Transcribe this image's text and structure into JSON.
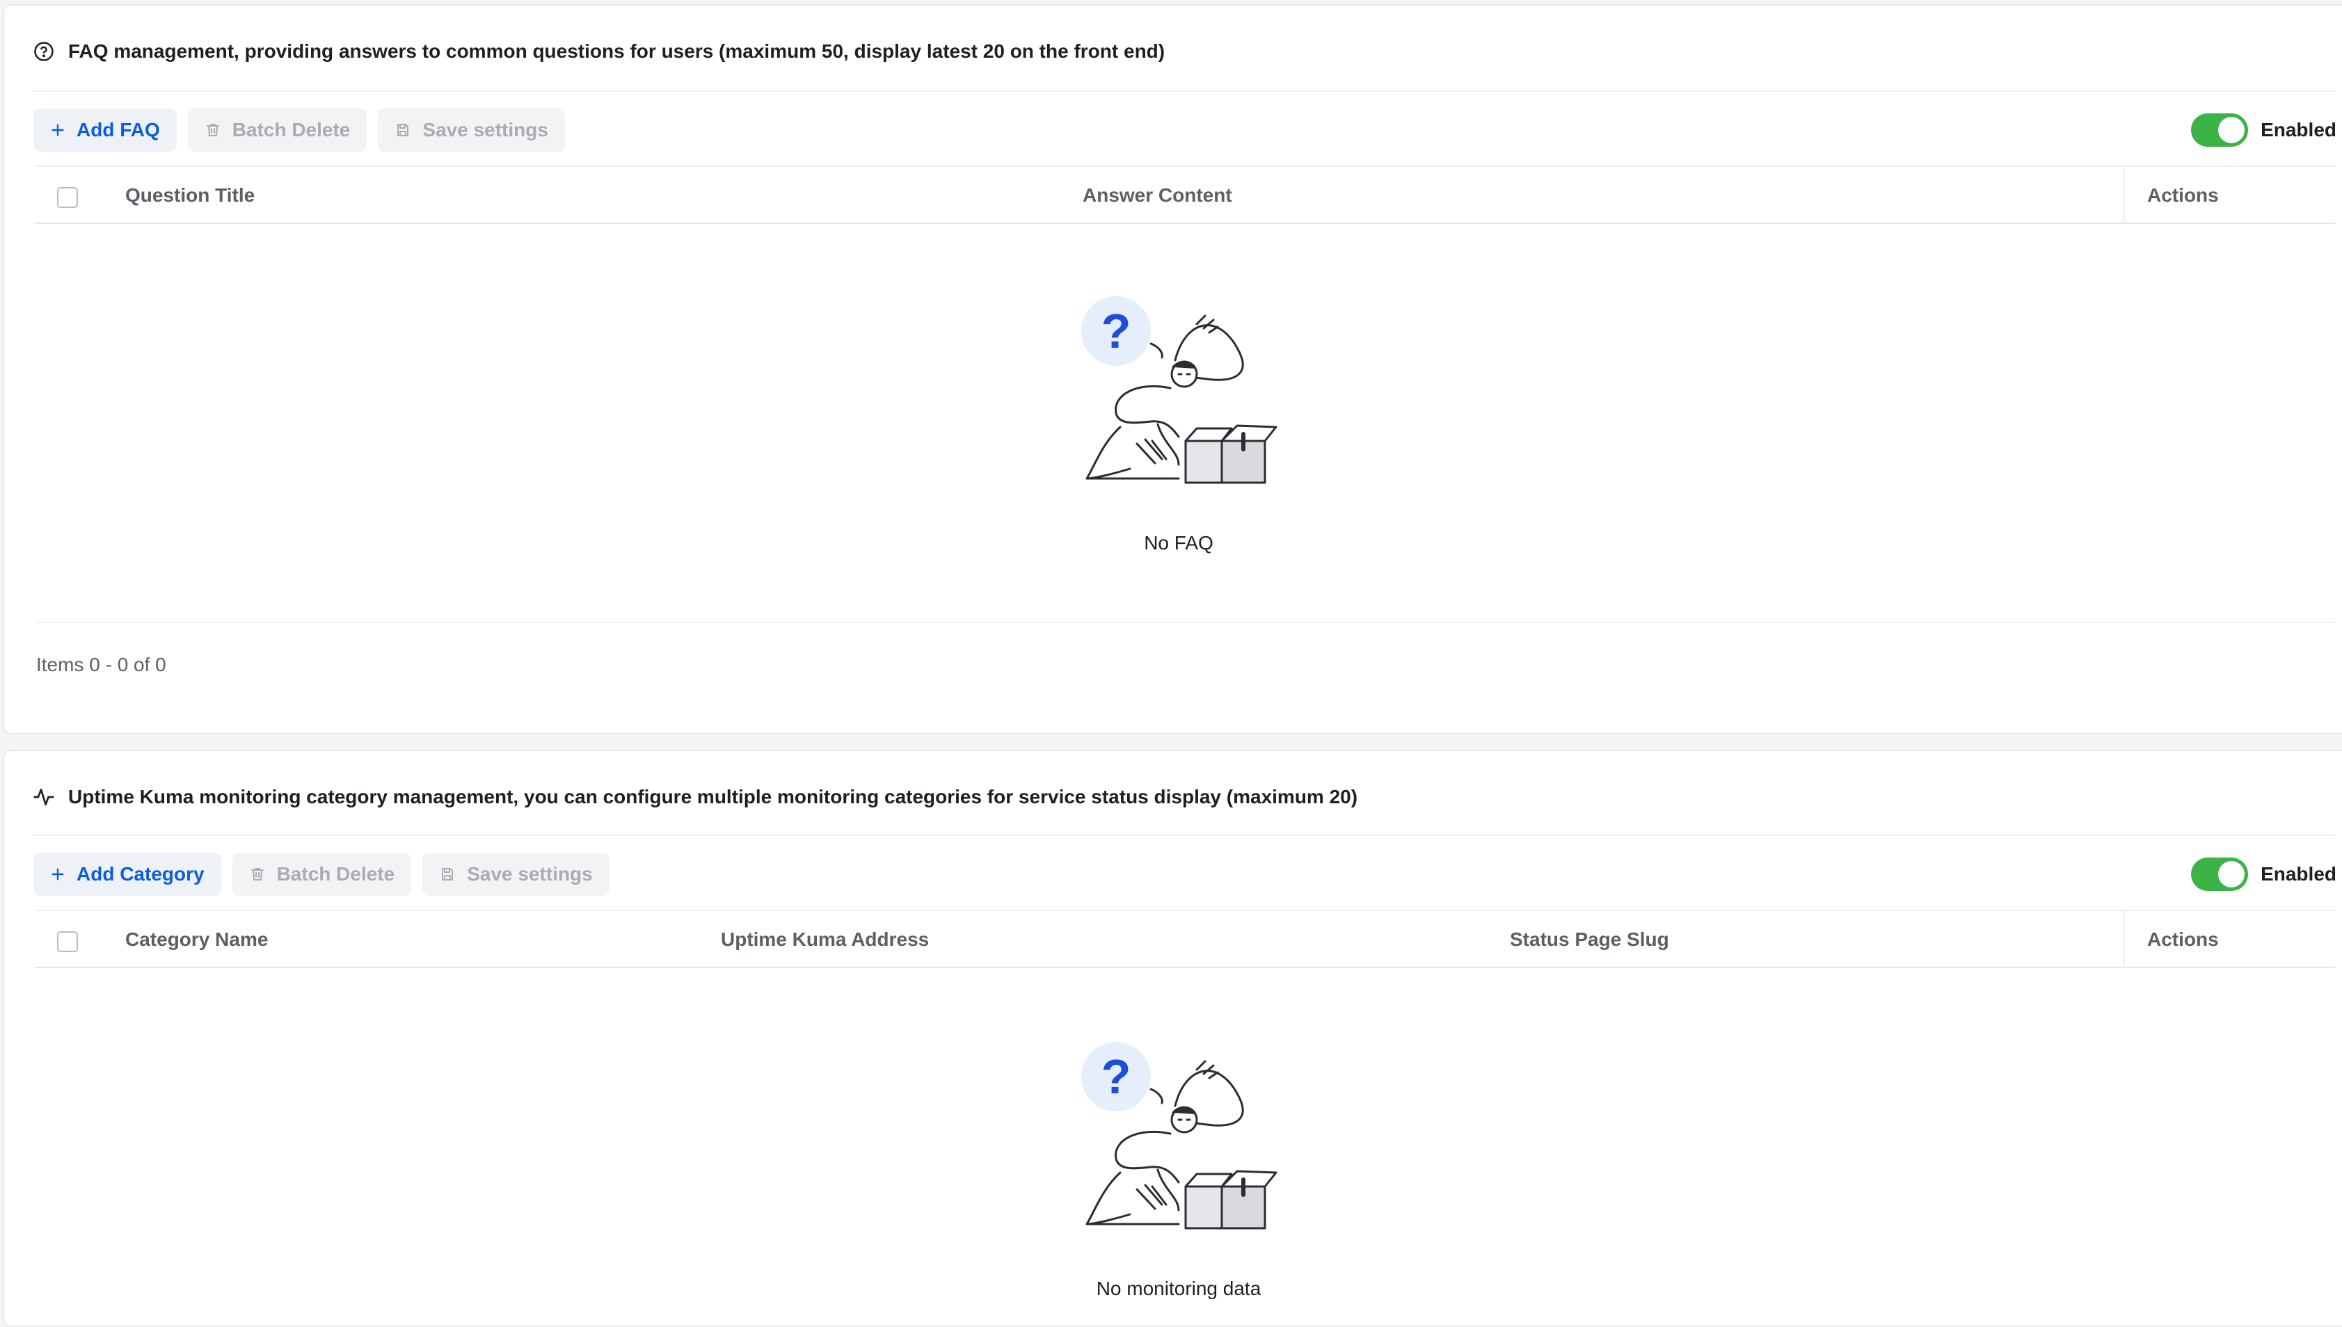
{
  "faq": {
    "title": "FAQ management, providing answers to common questions for users (maximum 50, display latest 20 on the front end)",
    "toolbar": {
      "add_label": "Add FAQ",
      "batch_delete_label": "Batch Delete",
      "save_label": "Save settings"
    },
    "switch": {
      "label": "Enabled",
      "on": true
    },
    "columns": [
      "Question Title",
      "Answer Content",
      "Actions"
    ],
    "rows": [],
    "empty_text": "No FAQ",
    "pagination": "Items 0 - 0 of 0"
  },
  "uptime": {
    "title": "Uptime Kuma monitoring category management, you can configure multiple monitoring categories for service status display (maximum 20)",
    "toolbar": {
      "add_label": "Add Category",
      "batch_delete_label": "Batch Delete",
      "save_label": "Save settings"
    },
    "switch": {
      "label": "Enabled",
      "on": true
    },
    "columns": [
      "Category Name",
      "Uptime Kuma Address",
      "Status Page Slug",
      "Actions"
    ],
    "rows": [],
    "empty_text": "No monitoring data"
  },
  "icons": {
    "faq_header": "help-circle-icon",
    "uptime_header": "activity-icon",
    "add": "plus-icon",
    "delete": "trash-icon",
    "save": "save-icon",
    "empty": "empty-state-illustration"
  },
  "colors": {
    "primary": "#0b5ddb",
    "switch_on": "#3bb346",
    "disabled_text": "#a9acb3"
  }
}
